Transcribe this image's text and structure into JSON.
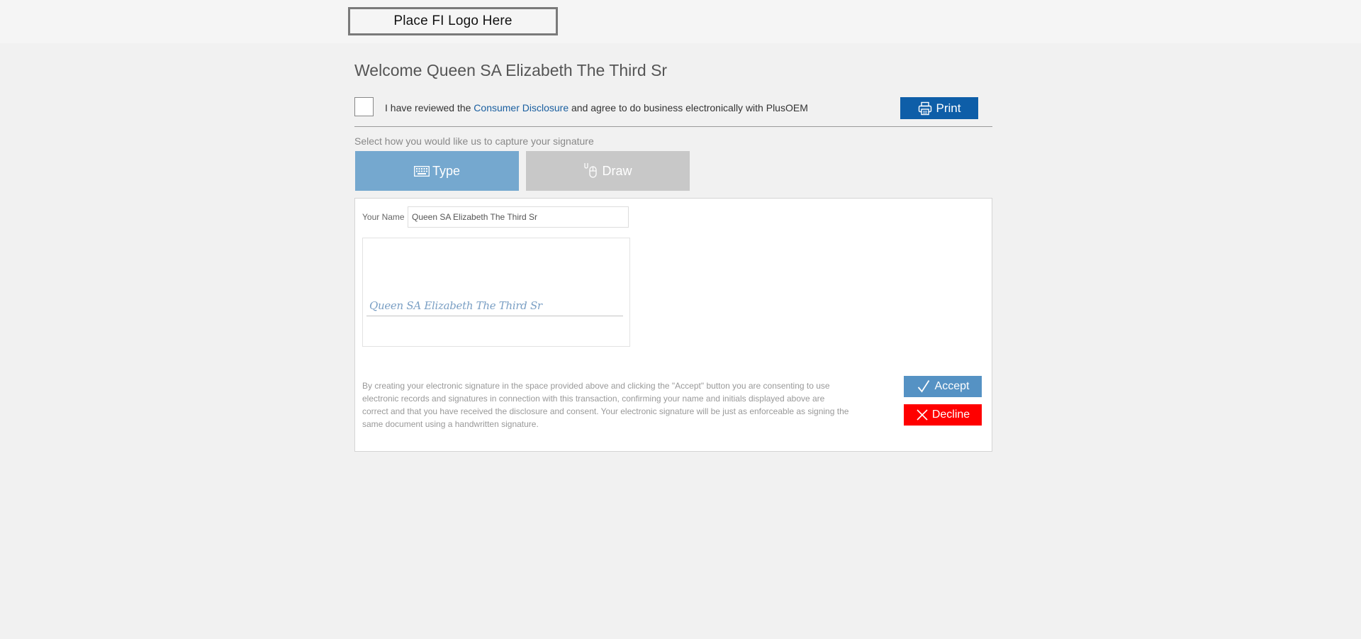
{
  "header": {
    "logo_text": "Place FI Logo Here"
  },
  "welcome": {
    "text": "Welcome Queen SA Elizabeth The Third Sr"
  },
  "agreement": {
    "prefix": "I have reviewed the ",
    "link_text": "Consumer Disclosure",
    "suffix": " and agree to do business electronically with PlusOEM",
    "checked": false
  },
  "toolbar": {
    "print_label": "Print"
  },
  "capture": {
    "label": "Select how you would like us to capture your signature",
    "tabs": [
      {
        "label": "Type",
        "icon": "keyboard-icon",
        "active": true
      },
      {
        "label": "Draw",
        "icon": "mouse-icon",
        "active": false
      }
    ]
  },
  "form": {
    "name_label": "Your Name",
    "name_value": "Queen SA Elizabeth The Third Sr",
    "signature_preview": "Queen SA Elizabeth The Third Sr"
  },
  "consent": {
    "text": "By creating your electronic signature in the space provided above and clicking the \"Accept\" button you are consenting to use electronic records and signatures in connection with this transaction, confirming your name and initials displayed above are correct and that you have received the disclosure and consent. Your electronic signature will be just as enforceable as signing the same document using a handwritten signature."
  },
  "actions": {
    "accept_label": "Accept",
    "decline_label": "Decline"
  },
  "colors": {
    "primary": "#0e5ea8",
    "tab_active": "#75a8cf",
    "tab_inactive": "#c8c8c8",
    "accept": "#5592c4",
    "decline": "#ff0000",
    "link": "#1a5fa0"
  }
}
